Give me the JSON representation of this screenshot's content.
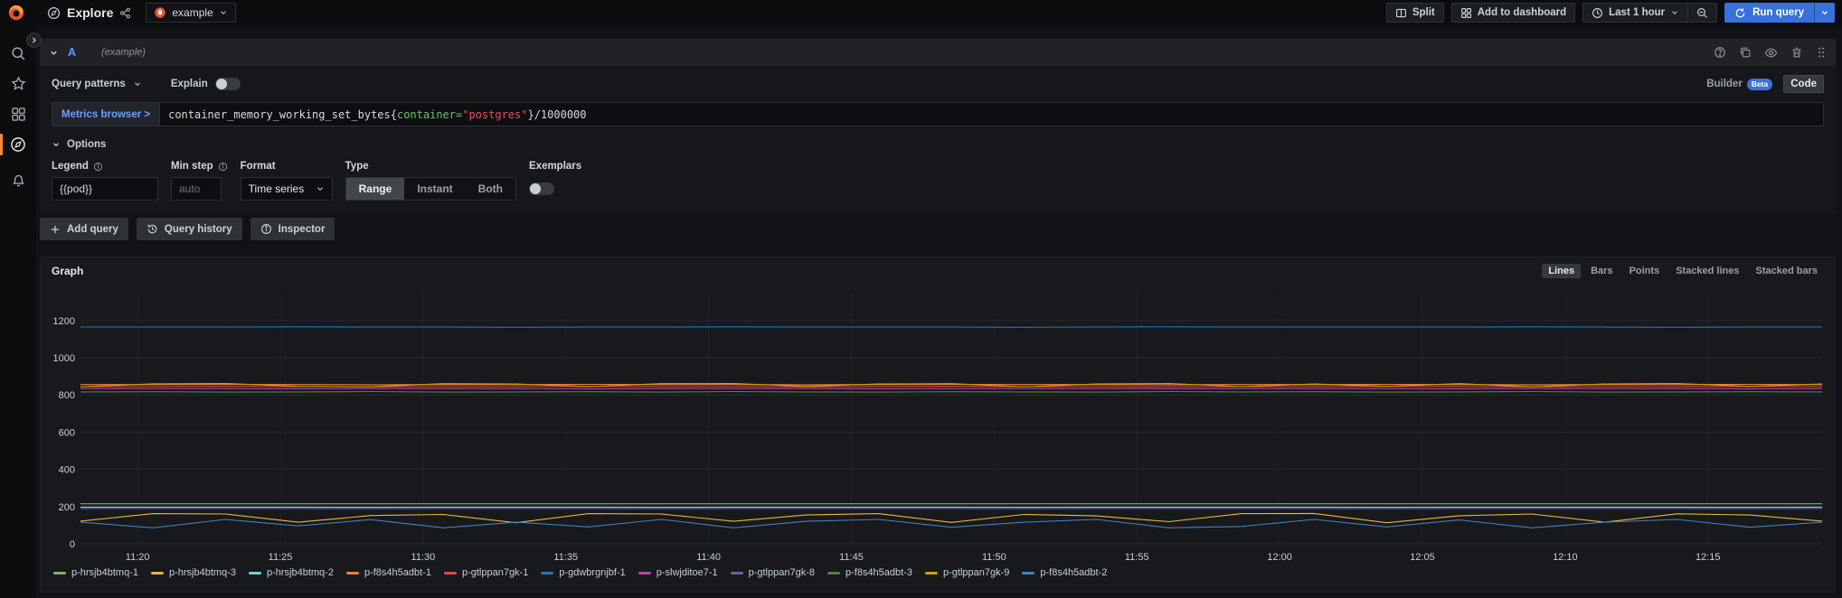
{
  "topbar": {
    "title": "Explore",
    "datasource": "example",
    "split_label": "Split",
    "add_to_dashboard_label": "Add to dashboard",
    "time_range_label": "Last 1 hour",
    "run_query_label": "Run query"
  },
  "query_editor": {
    "ref_id": "A",
    "datasource_hint": "(example)",
    "query_patterns_label": "Query patterns",
    "explain_label": "Explain",
    "builder_label": "Builder",
    "beta_label": "Beta",
    "code_label": "Code",
    "metrics_browser_label": "Metrics browser >",
    "query": "container_memory_working_set_bytes{container=\"postgres\"}/1000000",
    "query_parts": [
      {
        "text": "container_memory_working_set_bytes{",
        "type": "plain"
      },
      {
        "text": "container=",
        "type": "label"
      },
      {
        "text": "\"postgres\"",
        "type": "string"
      },
      {
        "text": "}/1000000",
        "type": "plain"
      }
    ],
    "options": {
      "section_label": "Options",
      "legend_label": "Legend",
      "legend_value": "{{pod}}",
      "min_step_label": "Min step",
      "min_step_placeholder": "auto",
      "format_label": "Format",
      "format_value": "Time series",
      "type_label": "Type",
      "type_options": [
        "Range",
        "Instant",
        "Both"
      ],
      "type_selected": "Range",
      "exemplars_label": "Exemplars"
    }
  },
  "actions": {
    "add_query_label": "Add query",
    "query_history_label": "Query history",
    "inspector_label": "Inspector"
  },
  "graph_panel": {
    "title": "Graph",
    "modes": [
      "Lines",
      "Bars",
      "Points",
      "Stacked lines",
      "Stacked bars"
    ],
    "selected_mode": "Lines"
  },
  "chart_data": {
    "type": "line",
    "title": "Graph",
    "xlabel": "",
    "ylabel": "",
    "grid": true,
    "legend_position": "bottom",
    "ylim": [
      0,
      1340
    ],
    "y_ticks": [
      0,
      200,
      400,
      600,
      800,
      1000,
      1200
    ],
    "x_ticks": [
      "11:20",
      "11:25",
      "11:30",
      "11:35",
      "11:40",
      "11:45",
      "11:50",
      "11:55",
      "12:00",
      "12:05",
      "12:10",
      "12:15"
    ],
    "x_range_minutes": [
      678,
      739
    ],
    "x_tick_start_minute": 680,
    "x_tick_step_minutes": 5,
    "series": [
      {
        "name": "p-hrsjb4btmq-1",
        "color": "#7EB26D",
        "values": [
          215,
          215,
          215,
          215,
          215,
          215,
          215,
          215,
          215,
          215,
          215,
          215,
          215,
          215,
          215,
          215,
          215,
          215,
          215,
          215,
          215,
          215,
          215,
          215,
          215
        ]
      },
      {
        "name": "p-hrsjb4btmq-3",
        "color": "#EAB839",
        "values": [
          122,
          162,
          160,
          116,
          152,
          158,
          113,
          162,
          160,
          121,
          155,
          162,
          115,
          158,
          150,
          119,
          162,
          163,
          113,
          151,
          160,
          116,
          161,
          155,
          122
        ]
      },
      {
        "name": "p-hrsjb4btmq-2",
        "color": "#6ED0E0",
        "values": [
          197,
          197,
          197,
          197,
          196,
          197,
          197,
          197,
          196,
          197,
          197,
          197,
          197,
          196,
          197,
          197,
          197,
          197,
          196,
          197,
          197,
          197,
          197,
          196,
          197
        ]
      },
      {
        "name": "p-f8s4h5adbt-1",
        "color": "#EF843C",
        "values": [
          856,
          856,
          857,
          856,
          855,
          856,
          856,
          857,
          856,
          856,
          855,
          856,
          857,
          856,
          856,
          855,
          856,
          856,
          857,
          856,
          855,
          856,
          856,
          857,
          856
        ]
      },
      {
        "name": "p-gtlppan7gk-1",
        "color": "#E24D42",
        "values": [
          845,
          845,
          846,
          845,
          844,
          845,
          845,
          846,
          845,
          845,
          844,
          845,
          846,
          845,
          845,
          844,
          845,
          845,
          846,
          845,
          844,
          845,
          845,
          846,
          845
        ]
      },
      {
        "name": "p-gdwbrgnjbf-1",
        "color": "#1F78C1",
        "values": [
          1165,
          1165,
          1165,
          1166,
          1165,
          1165,
          1164,
          1165,
          1165,
          1166,
          1165,
          1165,
          1165,
          1164,
          1165,
          1166,
          1165,
          1165,
          1165,
          1165,
          1166,
          1165,
          1164,
          1165,
          1165
        ]
      },
      {
        "name": "p-slwjditoe7-1",
        "color": "#BA43A9",
        "values": [
          834,
          834,
          834,
          833,
          834,
          834,
          834,
          833,
          834,
          834,
          834,
          833,
          834,
          834,
          834,
          833,
          834,
          834,
          834,
          833,
          834,
          834,
          834,
          833,
          834
        ]
      },
      {
        "name": "p-gtlppan7gk-8",
        "color": "#705DA0",
        "values": [
          190,
          190,
          190,
          190,
          189,
          190,
          190,
          190,
          189,
          190,
          190,
          190,
          190,
          189,
          190,
          190,
          190,
          190,
          189,
          190,
          190,
          190,
          190,
          189,
          190
        ]
      },
      {
        "name": "p-f8s4h5adbt-3",
        "color": "#508642",
        "values": [
          816,
          817,
          815,
          816,
          818,
          815,
          816,
          817,
          815,
          818,
          816,
          815,
          817,
          816,
          815,
          818,
          816,
          817,
          815,
          816,
          818,
          815,
          816,
          817,
          816
        ]
      },
      {
        "name": "p-gtlppan7gk-9",
        "color": "#CCA300",
        "values": [
          844,
          860,
          862,
          846,
          844,
          861,
          859,
          845,
          861,
          862,
          846,
          859,
          861,
          844,
          859,
          862,
          845,
          859,
          846,
          861,
          844,
          859,
          862,
          846,
          859
        ]
      },
      {
        "name": "p-f8s4h5adbt-2",
        "color": "#447EBC",
        "values": [
          116,
          86,
          131,
          96,
          130,
          86,
          116,
          91,
          131,
          86,
          121,
          131,
          89,
          116,
          131,
          86,
          93,
          131,
          91,
          128,
          86,
          116,
          131,
          89,
          116
        ]
      }
    ]
  },
  "colors": {
    "accent_blue": "#3871dc",
    "link_blue": "#6e9fff",
    "orange_brand": "#ff8833",
    "panel_bg": "#17191d",
    "page_bg": "#111217"
  }
}
